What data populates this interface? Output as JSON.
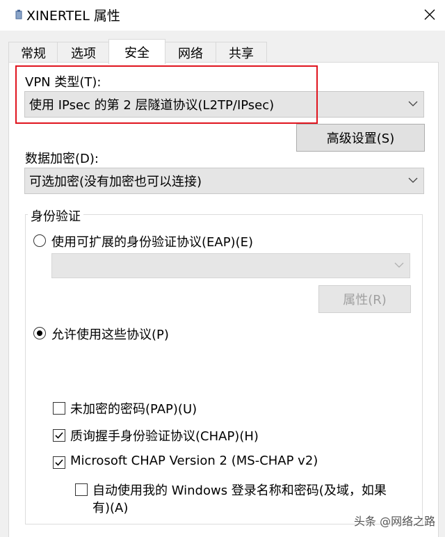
{
  "window": {
    "title": "XINERTEL 属性"
  },
  "tabs": [
    {
      "label": "常规"
    },
    {
      "label": "选项"
    },
    {
      "label": "安全"
    },
    {
      "label": "网络"
    },
    {
      "label": "共享"
    }
  ],
  "vpn": {
    "label": "VPN 类型(T):",
    "value": "使用 IPsec 的第 2 层隧道协议(L2TP/IPsec)"
  },
  "advanced_button": "高级设置(S)",
  "encryption": {
    "label": "数据加密(D):",
    "value": "可选加密(没有加密也可以连接)"
  },
  "auth": {
    "group_title": "身份验证",
    "eap_radio": "使用可扩展的身份验证协议(EAP)(E)",
    "eap_select_value": "",
    "properties_button": "属性(R)",
    "allow_radio": "允许使用这些协议(P)",
    "protocols": [
      {
        "label": "未加密的密码(PAP)(U)",
        "checked": false
      },
      {
        "label": "质询握手身份验证协议(CHAP)(H)",
        "checked": true
      },
      {
        "label": "Microsoft CHAP Version 2 (MS-CHAP v2)",
        "checked": true
      }
    ],
    "auto_logon": {
      "line1": "自动使用我的 Windows 登录名称和密码(及域，如果",
      "line2": "有)(A)",
      "checked": false
    }
  },
  "watermark": "头条 @网络之路",
  "colors": {
    "highlight": "#e0141e",
    "panel": "#ffffff",
    "window_bg": "#f0f0f0"
  }
}
